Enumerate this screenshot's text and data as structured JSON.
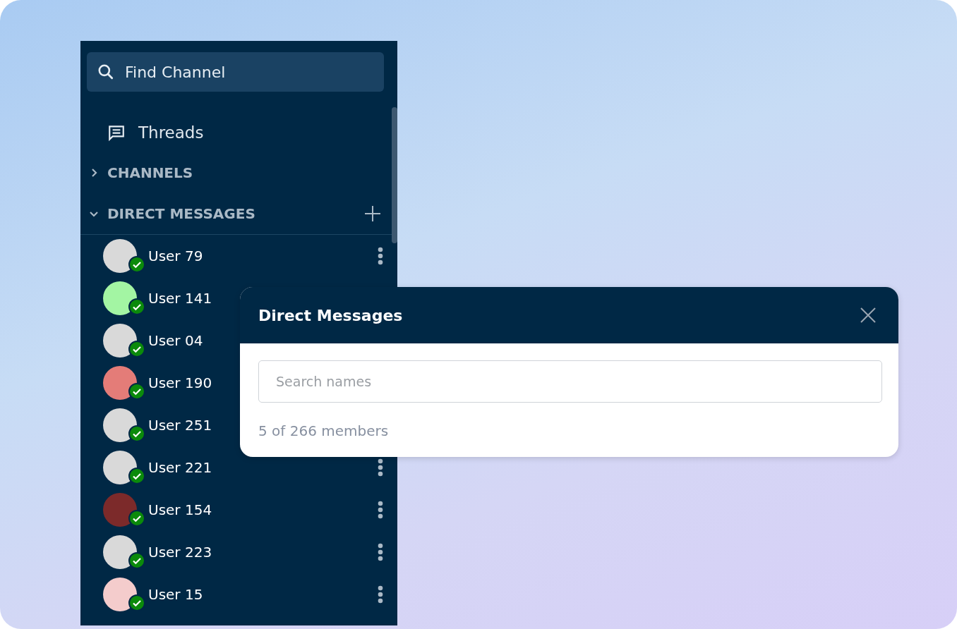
{
  "sidebar": {
    "search": {
      "placeholder": "Find Channel"
    },
    "threads": {
      "label": "Threads"
    },
    "sections": [
      {
        "label": "CHANNELS",
        "expanded": false,
        "add": false
      },
      {
        "label": "DIRECT MESSAGES",
        "expanded": true,
        "add": true
      }
    ],
    "direct_messages": [
      {
        "name": "User 79",
        "color": "#d9d9d9"
      },
      {
        "name": "User 141",
        "color": "#a3f5a3"
      },
      {
        "name": "User 04",
        "color": "#d9d9d9"
      },
      {
        "name": "User 190",
        "color": "#e47c78"
      },
      {
        "name": "User 251",
        "color": "#d9d9d9"
      },
      {
        "name": "User 221",
        "color": "#d9d9d9"
      },
      {
        "name": "User 154",
        "color": "#7c2a2a"
      },
      {
        "name": "User 223",
        "color": "#d9d9d9"
      },
      {
        "name": "User 15",
        "color": "#f4cccc"
      }
    ]
  },
  "dialog": {
    "title": "Direct Messages",
    "search": {
      "placeholder": "Search names"
    },
    "count": "5 of 266 members"
  }
}
